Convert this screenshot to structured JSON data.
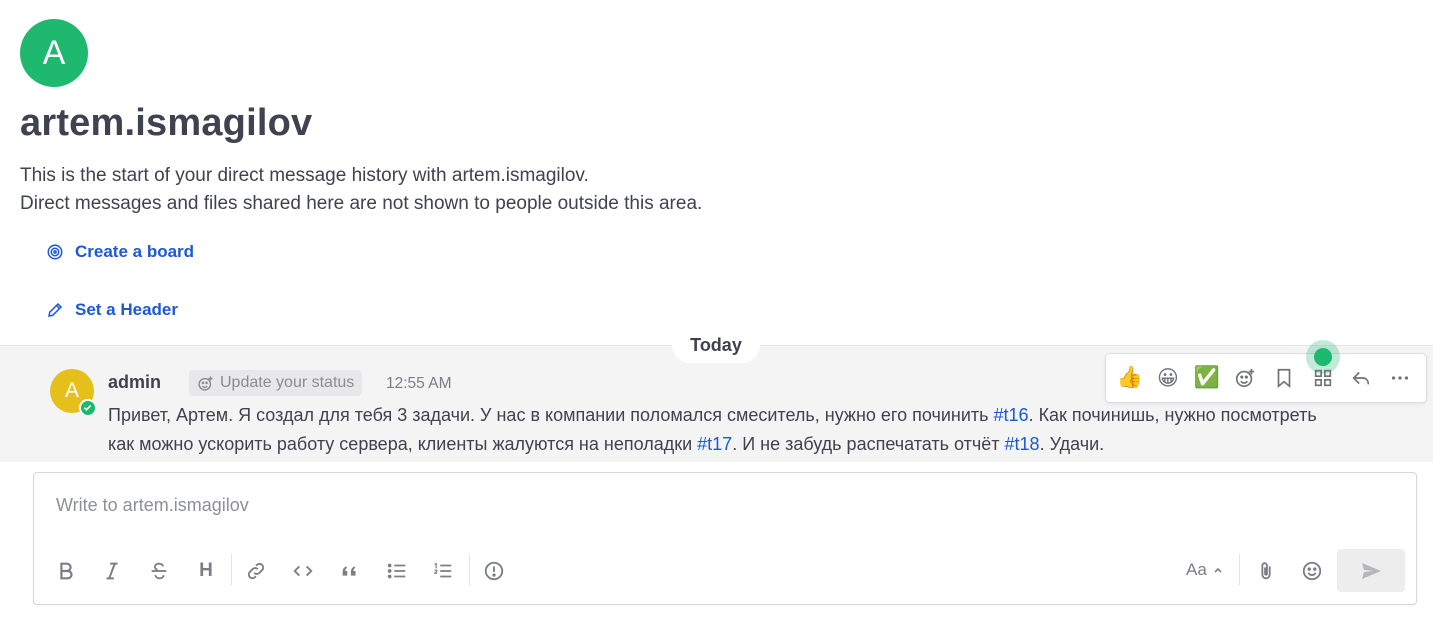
{
  "channel": {
    "avatar_initial": "A",
    "title": "artem.ismagilov",
    "intro_line_1": "This is the start of your direct message history with artem.ismagilov.",
    "intro_line_2": "Direct messages and files shared here are not shown to people outside this area.",
    "actions": {
      "create_board": "Create a board",
      "set_header": "Set a Header"
    }
  },
  "date_separator": "Today",
  "post": {
    "avatar_initial": "A",
    "author": "admin",
    "status_chip": "Update your status",
    "time": "12:55 AM",
    "message": {
      "part1": "Привет, Артем. Я создал для тебя 3 задачи. У нас в компании поломался смеситель, нужно его починить ",
      "link1": "#t16",
      "part2": ". Как починишь, нужно посмотреть как можно ускорить работу сервера, клиенты жалуются на неполадки ",
      "link2": "#t17",
      "part3": ". И не забудь распечатать отчёт ",
      "link3": "#t18",
      "part4": ". Удачи."
    }
  },
  "hover_toolbar": {
    "reactions": [
      "👍",
      "😀",
      "✅"
    ],
    "icons": [
      "emoji-add-icon",
      "bookmark-icon",
      "apps-grid-icon",
      "reply-icon",
      "more-icon"
    ]
  },
  "composer": {
    "placeholder": "Write to artem.ismagilov",
    "format_heading": "H",
    "text_size_toggle": "Aa"
  },
  "colors": {
    "accent": "#1c58d9",
    "online": "#1fb86f",
    "post_background": "#f4f4f5"
  }
}
